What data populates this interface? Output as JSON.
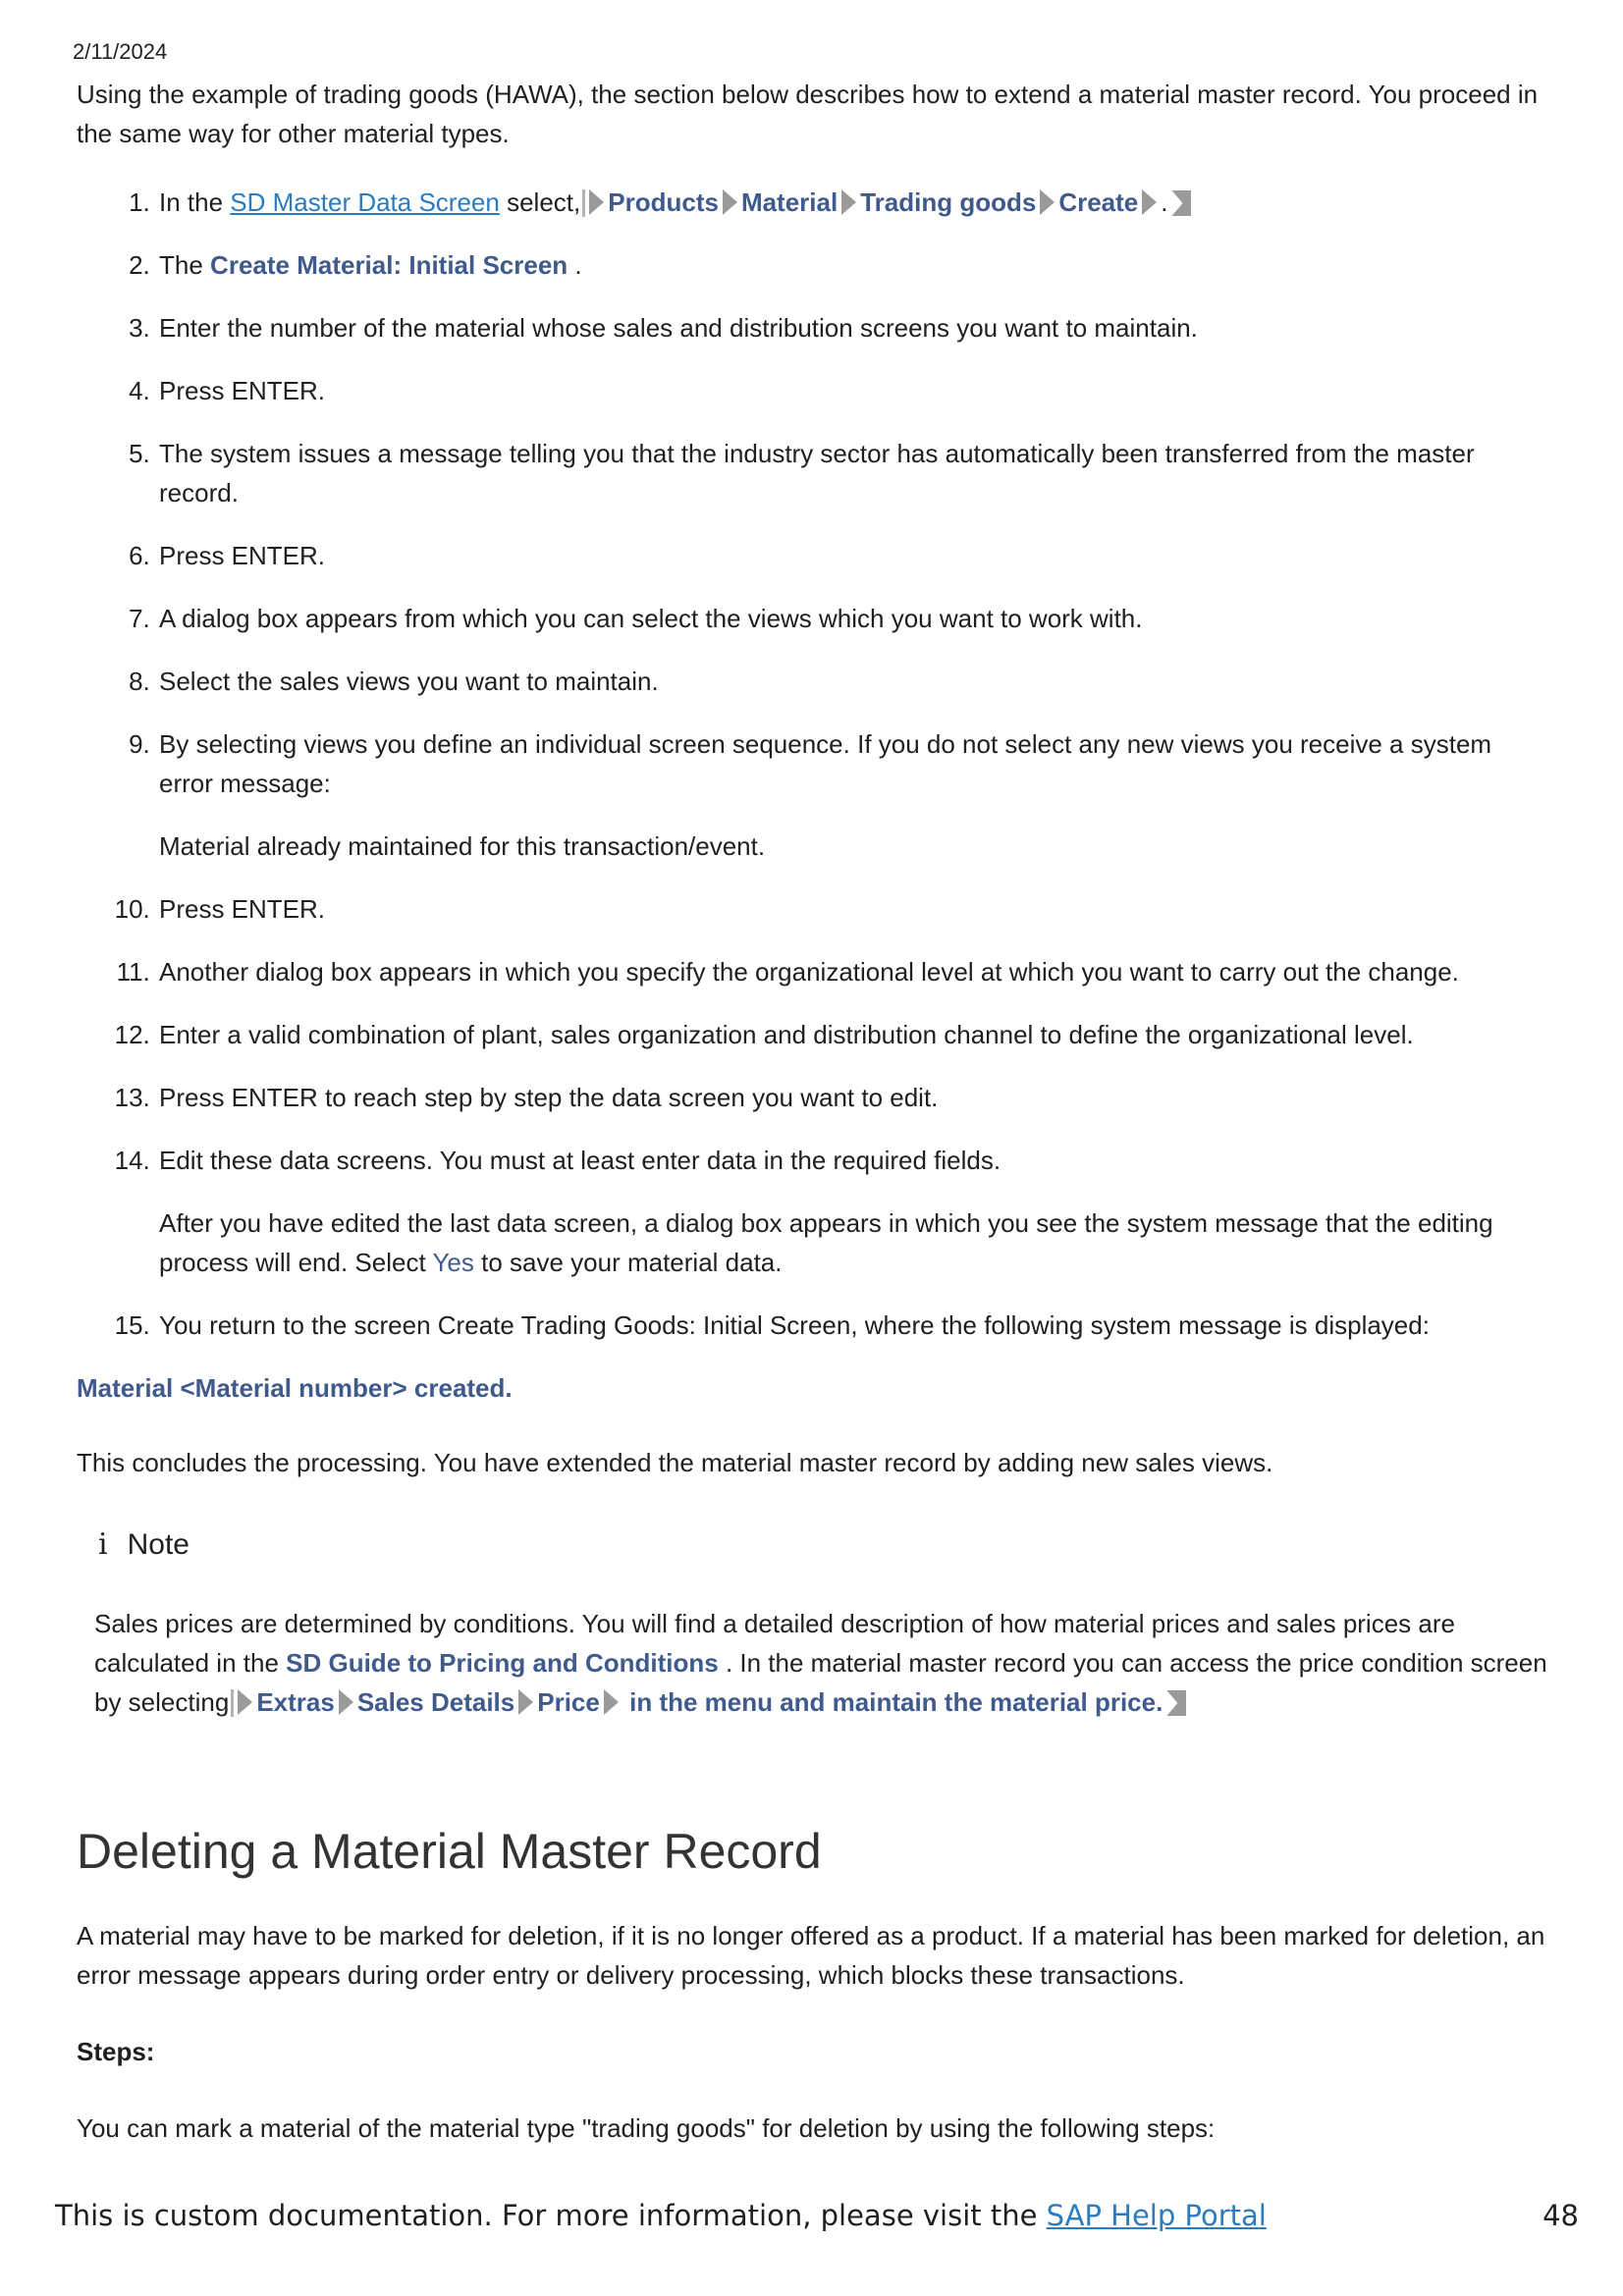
{
  "header": {
    "date": "2/11/2024"
  },
  "intro": "Using the example of trading goods (HAWA), the section below describes how to extend a material master record. You proceed in the same way for other material types.",
  "steps": {
    "s1_prefix": "In the",
    "s1_link": "SD Master Data Screen",
    "s1_mid": "select,",
    "s1_path": [
      "Products",
      "Material",
      "Trading goods",
      "Create"
    ],
    "s1_suffix": ".",
    "s2_prefix": "The",
    "s2_ui": "Create Material: Initial Screen",
    "s2_suffix": ".",
    "s3": "Enter the number of the material whose sales and distribution screens you want to maintain.",
    "s4": "Press ENTER.",
    "s5": "The system issues a message telling you that the industry sector has automatically been transferred from the master record.",
    "s6": "Press ENTER.",
    "s7": "A dialog box appears from which you can select the views which you want to work with.",
    "s8": "Select the sales views you want to maintain.",
    "s9": "By selecting views you define an individual screen sequence. If you do not select any new views you receive a system error message:",
    "s9_sub": "Material already maintained for this transaction/event.",
    "s10": "Press ENTER.",
    "s11": "Another dialog box appears in which you specify the organizational level at which you want to carry out the change.",
    "s12": "Enter a valid combination of plant, sales organization and distribution channel to define the organizational level.",
    "s13": "Press ENTER to reach step by step the data screen you want to edit.",
    "s14": "Edit these data screens. You must at least enter data in the required fields.",
    "s14_sub_prefix": "After you have edited the last data screen, a dialog box appears in which you see the system message that the editing process will end. Select",
    "s14_sub_ui": "Yes",
    "s14_sub_suffix": "to save your material data.",
    "s15": "You return to the screen Create Trading Goods: Initial Screen, where the following system message is displayed:"
  },
  "created_msg": "Material <Material number> created.",
  "conclusion": "This concludes the processing. You have extended the material master record by adding new sales views.",
  "note": {
    "icon": "i",
    "title": "Note",
    "text_prefix": "Sales prices are determined by conditions. You will find a detailed description of how material prices and sales prices are calculated in the",
    "guide": "SD Guide to Pricing and Conditions",
    "text_mid": ". In the material master record you can access the price condition screen by selecting",
    "path": [
      "Extras",
      "Sales Details",
      "Price"
    ],
    "path_tail": "in the menu and maintain the material price."
  },
  "section": {
    "title": "Deleting a Material Master Record",
    "para": "A material may have to be marked for deletion, if it is no longer offered as a product. If a material has been marked for deletion, an error message appears during order entry or delivery processing, which blocks these transactions.",
    "steps_label": "Steps:",
    "final": "You can mark a material of the material type \"trading goods\" for deletion by using the following steps:"
  },
  "footer": {
    "text": "This is custom documentation. For more information, please visit the",
    "link": "SAP Help Portal",
    "page": "48"
  }
}
